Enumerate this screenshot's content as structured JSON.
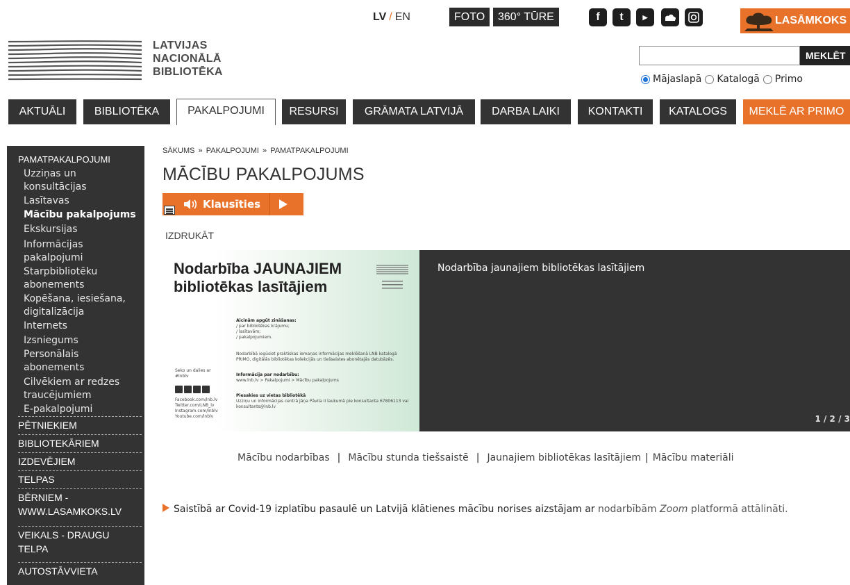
{
  "site": {
    "logo_lines": [
      "LATVIJAS",
      "NACIONĀLĀ",
      "BIBLIOTĒKA"
    ]
  },
  "topbar": {
    "lang_current": "LV",
    "lang_sep": "/",
    "lang_other": "EN",
    "foto": "FOTO",
    "tours": "360° TŪRE",
    "lasamkoks": "LASĀMKOKS"
  },
  "search": {
    "input_value": "",
    "button": "MEKLĒT",
    "options": [
      "Mājaslapā",
      "Katalogā",
      "Primo"
    ],
    "selected": "Mājaslapā"
  },
  "nav": {
    "items": [
      "AKTUĀLI",
      "BIBLIOTĒKA",
      "PAKALPOJUMI",
      "RESURSI",
      "GRĀMATA LATVIJĀ",
      "DARBA LAIKI",
      "KONTAKTI",
      "KATALOGS",
      "MEKLĒ AR PRIMO"
    ],
    "active": "PAKALPOJUMI"
  },
  "sidebar": {
    "heading": "PAMATPAKALPOJUMI",
    "sub_items": [
      "Uzziņas un konsultācijas",
      "Lasītavas",
      "Mācību pakalpojums",
      "Ekskursijas",
      "Informācijas pakalpojumi",
      "Starpbibliotēku abonements",
      "Kopēšana, iesiešana, digitalizācija",
      "Internets",
      "Izsniegums",
      "Personālais abonements",
      "Cilvēkiem ar redzes traucējumiem",
      "E-pakalpojumi"
    ],
    "current": "Mācību pakalpojums",
    "sections": [
      "PĒTNIEKIEM",
      "BIBLIOTEKĀRIEM",
      "IZDEVĒJIEM",
      "TELPAS",
      "BĒRNIEM - WWW.LASAMKOKS.LV",
      "VEIKALS - DRAUGU TELPA",
      "AUTOSTĀVVIETA"
    ]
  },
  "content": {
    "breadcrumb": [
      "SĀKUMS",
      "PAKALPOJUMI",
      "PAMATPAKALPOJUMI"
    ],
    "breadcrumb_sep": "»",
    "title": "MĀCĪBU PAKALPOJUMS",
    "listen_label": "Klausīties",
    "print": "IZDRUKĀT",
    "slide": {
      "headline": "Nodarbība JAUNAJIEM bibliotēkas lasītājiem",
      "caption": "Nodarbība jaunajiem bibliotēkas lasītājiem",
      "pager": "1 / 2 / 3",
      "aicinam_title": "Aicinām apgūt zināšanas:",
      "aicinam_items": [
        "/ par bibliotēkas krājumu;",
        "/ lasītavām;",
        "/ pakalpojumiem."
      ],
      "body": "Nodarbībā iegūsiet praktiskas iemaņas informācijas meklēšanā LNB katalogā PRIMO, digitālās bibliotēkas kolekcijās un tiešsaistes abonētajās datubāzēs.",
      "info_title": "Informācija par nodarbību:",
      "info_text": "www.lnb.lv > Pakalpojumi > Mācību pakalpojums",
      "signup_title": "Piesakies uz vietas bibliotēkā",
      "signup_text": "Uzziņu un informācijas centrā Jāņa Pāvila II laukumā pie konsultanta 67806113 vai konsultants@lnb.lv",
      "follow": "Seko un dalies ar #lnblv",
      "social_links": "Facebook.com/lnb.lv Twitter.com/LNB_lv Instagram.com/lnblv Youtube.com/lnblv"
    },
    "links": [
      "Mācību nodarbības",
      "Mācību stunda tiešsaistē",
      "Jaunajiem bibliotēkas lasītājiem",
      "Mācību materiāli"
    ],
    "links_sep": "|",
    "notice_pre": "Saistībā ar Covid-19 izplatību pasaulē un Latvijā klātienes mācību norises aizstājam ar",
    "notice_link_a": "nodarbībām",
    "notice_em": "Zoom",
    "notice_link_b": "platformā attālināti."
  },
  "colors": {
    "accent": "#e8722a",
    "dark": "#333333",
    "radio": "#1e73d8"
  }
}
